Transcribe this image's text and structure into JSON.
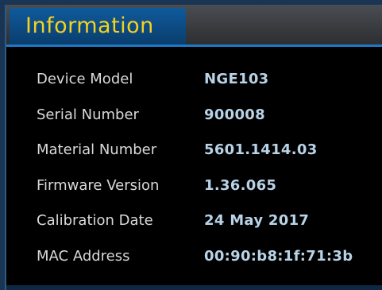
{
  "panel": {
    "title": "Information"
  },
  "info": {
    "rows": [
      {
        "label": "Device Model",
        "value": "NGE103"
      },
      {
        "label": "Serial Number",
        "value": "900008"
      },
      {
        "label": "Material Number",
        "value": "5601.1414.03"
      },
      {
        "label": "Firmware Version",
        "value": "1.36.065"
      },
      {
        "label": "Calibration Date",
        "value": "24 May 2017"
      },
      {
        "label": "MAC Address",
        "value": "00:90:b8:1f:71:3b"
      }
    ]
  },
  "colors": {
    "title_text": "#f3d21f",
    "title_tab": "#0f5a9c",
    "accent_line": "#1f78c4",
    "label_text": "#d9d9d9",
    "value_text": "#b8d2e6",
    "background": "#000000"
  }
}
